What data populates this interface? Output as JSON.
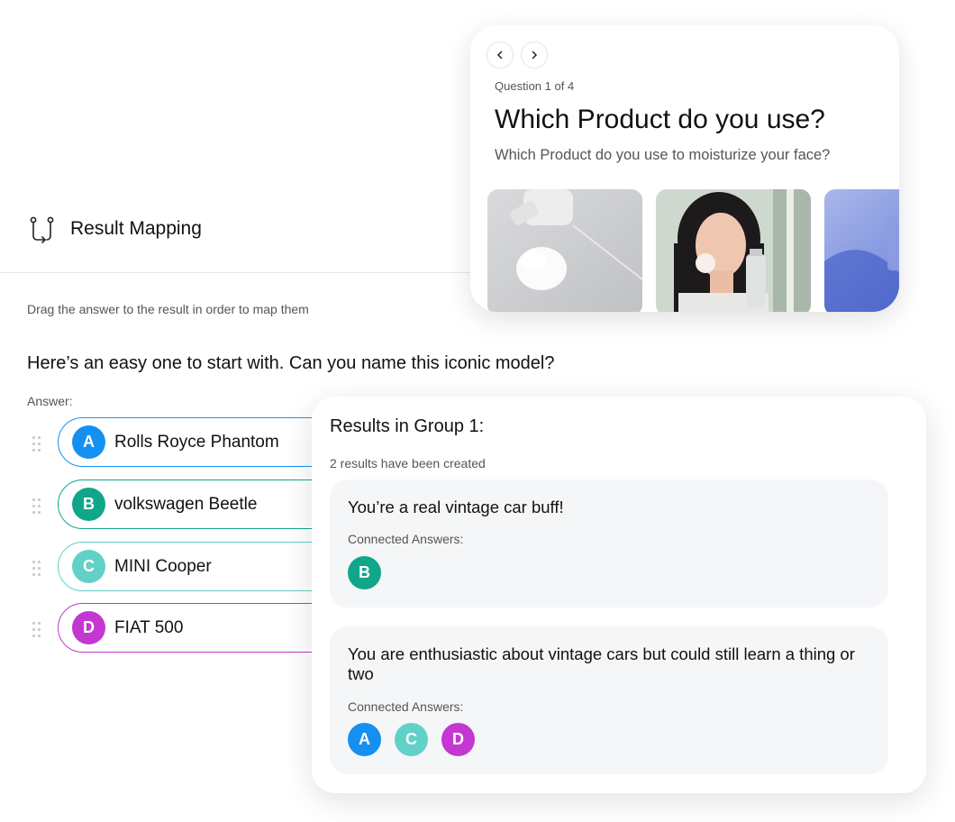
{
  "header": {
    "title": "Result Mapping",
    "icon": "route-icon"
  },
  "hint": "Drag the answer to the result in order to map them",
  "question": "Here’s an easy one to start with. Can you name this iconic model?",
  "answer_label": "Answer:",
  "answers": [
    {
      "letter": "A",
      "text": "Rolls Royce Phantom",
      "color": "#1690f0"
    },
    {
      "letter": "B",
      "text": "volkswagen Beetle",
      "color": "#11a68c"
    },
    {
      "letter": "C",
      "text": "MINI Cooper",
      "color": "#62d1c7"
    },
    {
      "letter": "D",
      "text": "FIAT 500",
      "color": "#c437d0"
    }
  ],
  "question_card": {
    "counter": "Question 1 of 4",
    "title": "Which Product do you use?",
    "subtitle": "Which Product do you use to moisturize your face?"
  },
  "results": {
    "title": "Results in Group 1:",
    "subtitle": "2 results have been created",
    "groups": [
      {
        "title": "You’re a real vintage car buff!",
        "label": "Connected Answers:",
        "answers": [
          "B"
        ]
      },
      {
        "title": "You are enthusiastic about vintage cars but could still learn a thing or two",
        "label": "Connected Answers:",
        "answers": [
          "A",
          "C",
          "D"
        ]
      }
    ]
  }
}
